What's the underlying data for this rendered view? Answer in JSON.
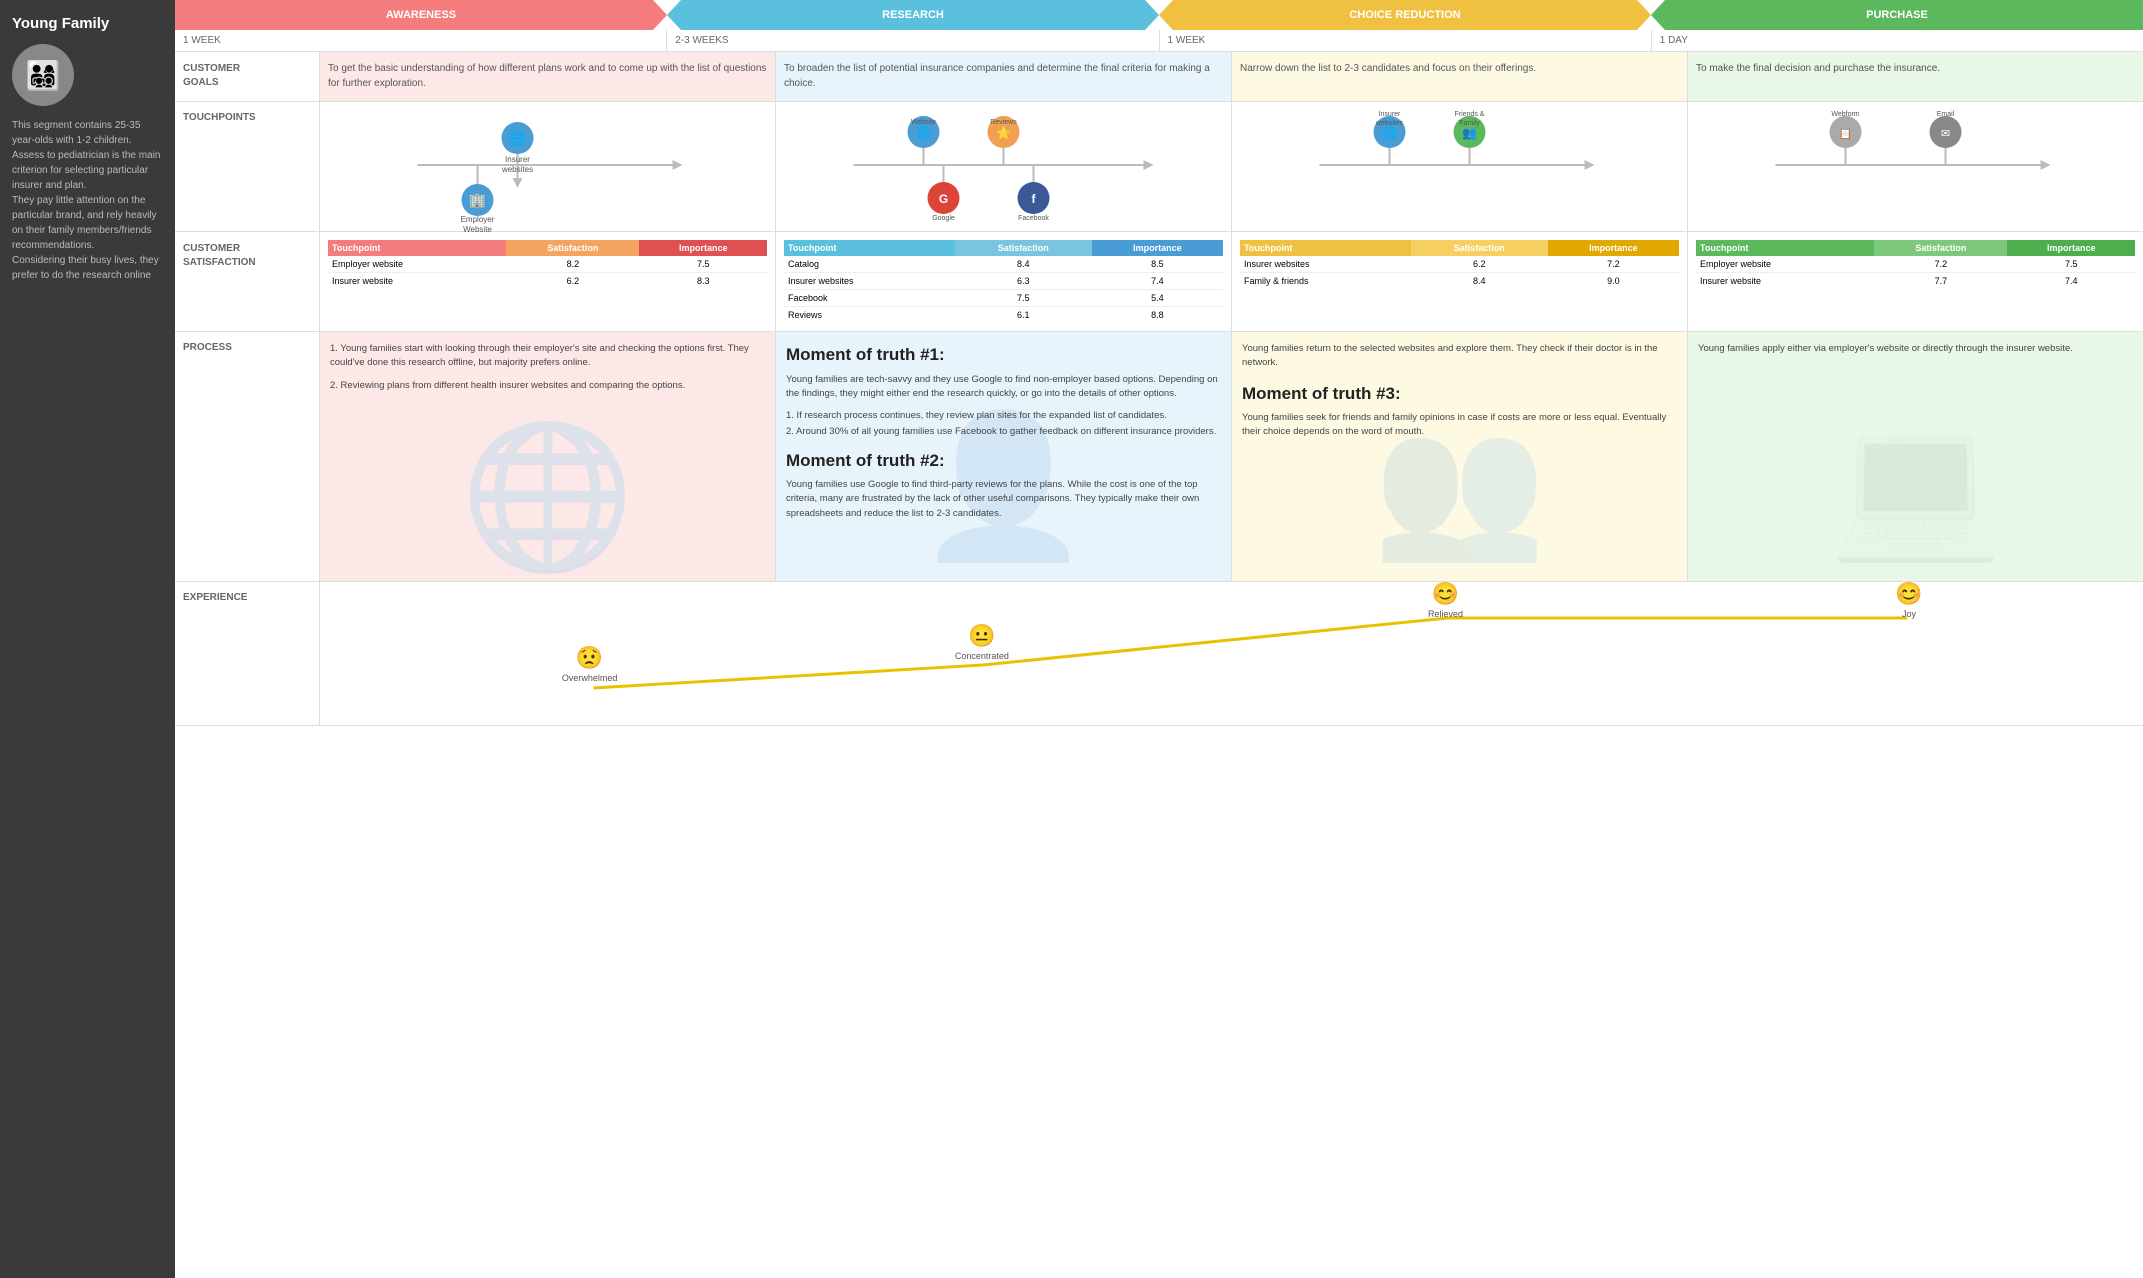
{
  "sidebar": {
    "title": "Young Family",
    "description": "This segment contains 25-35 year-olds with 1-2 children. Assess to pediatrician is the main criterion for selecting particular insurer and plan.\nThey pay little attention on the particular brand, and rely heavily on their family members/friends recommendations.\nConsidering their busy lives, they prefer to do the research online"
  },
  "phases": [
    {
      "id": "awareness",
      "label": "AWARENESS",
      "color": "#f47c7c",
      "bg": "#fde8e8"
    },
    {
      "id": "research",
      "label": "RESEARCH",
      "color": "#5bc0de",
      "bg": "#e8f4fb"
    },
    {
      "id": "choice",
      "label": "CHOICE REDUCTION",
      "color": "#f0c040",
      "bg": "#fdf9e3"
    },
    {
      "id": "purchase",
      "label": "PURCHASE",
      "color": "#5cb85c",
      "bg": "#e8f7e8"
    }
  ],
  "timeline": [
    "1 WEEK",
    "2-3 WEEKS",
    "1 WEEK",
    "1 DAY"
  ],
  "goals": [
    "To get the basic understanding of how different plans work and to come up with the list of questions for further exploration.",
    "To broaden the list of potential insurance companies and determine the final criteria for making a choice.",
    "Narrow down the list to 2-3 candidates and focus on their offerings.",
    "To make the final decision and purchase the insurance."
  ],
  "touchpoints": {
    "awareness": [
      {
        "label": "Insurer websites",
        "icon": "🌐",
        "color": "#4a9dd4",
        "y": "top"
      },
      {
        "label": "Employer Website",
        "icon": "🏢",
        "color": "#4a9dd4",
        "y": "bottom"
      }
    ],
    "research": [
      {
        "label": "Website",
        "icon": "🌐",
        "color": "#4a9dd4",
        "y": "top"
      },
      {
        "label": "Reviews",
        "icon": "⭐",
        "color": "#f0a050",
        "y": "top"
      },
      {
        "label": "Google",
        "icon": "G",
        "color": "#db4437",
        "y": "bottom"
      },
      {
        "label": "Facebook",
        "icon": "f",
        "color": "#3b5998",
        "y": "bottom"
      }
    ],
    "choice": [
      {
        "label": "Insurer websites",
        "icon": "🌐",
        "color": "#4a9dd4"
      },
      {
        "label": "Friends & Family",
        "icon": "👥",
        "color": "#5cb85c"
      }
    ],
    "purchase": [
      {
        "label": "Webform",
        "icon": "📋",
        "color": "#888"
      },
      {
        "label": "Email",
        "icon": "✉",
        "color": "#777"
      }
    ]
  },
  "satisfaction": {
    "awareness": {
      "headers": [
        "Touchpoint",
        "Satisfaction",
        "Importance"
      ],
      "rows": [
        [
          "Employer website",
          "8.2",
          "7.5"
        ],
        [
          "Insurer website",
          "6.2",
          "8.3"
        ]
      ]
    },
    "research": {
      "headers": [
        "Touchpoint",
        "Satisfaction",
        "Importance"
      ],
      "rows": [
        [
          "Catalog",
          "8.4",
          "8.5"
        ],
        [
          "Insurer websites",
          "6.3",
          "7.4"
        ],
        [
          "Facebook",
          "7.5",
          "5.4"
        ],
        [
          "Reviews",
          "6.1",
          "8.8"
        ]
      ]
    },
    "choice": {
      "headers": [
        "Touchpoint",
        "Satisfaction",
        "Importance"
      ],
      "rows": [
        [
          "Insurer websites",
          "6.2",
          "7.2"
        ],
        [
          "Family & friends",
          "8.4",
          "9.0"
        ]
      ]
    },
    "purchase": {
      "headers": [
        "Touchpoint",
        "Satisfaction",
        "Importance"
      ],
      "rows": [
        [
          "Employer website",
          "7.2",
          "7.5"
        ],
        [
          "Insurer website",
          "7.7",
          "7.4"
        ]
      ]
    }
  },
  "process": {
    "awareness": {
      "items": [
        "Young families start with looking through their employer's site and checking the options first. They could've done this research offline, but majority prefers online.",
        "Reviewing plans from different health insurer websites and comparing the options."
      ]
    },
    "research": {
      "moment1_title": "Moment of truth #1:",
      "moment1_text": "Young families are tech-savvy and they use Google to find non-employer based options. Depending on the findings, they might either end the research quickly, or go into the details of other options.",
      "sub_items": [
        "If research process continues, they review plan sites for the expanded list of candidates.",
        "Around 30% of all young families use Facebook to gather feedback on different insurance providers."
      ],
      "moment2_title": "Moment of truth #2:",
      "moment2_text": "Young families use Google to find third-party reviews for the plans. While the cost is one of the top criteria, many are frustrated by the lack of other useful comparisons. They typically make their own spreadsheets and reduce the list to 2-3 candidates."
    },
    "choice": {
      "text": "Young families return to the selected websites and explore them. They check if their doctor is in the network.",
      "moment3_title": "Moment of truth #3:",
      "moment3_text": "Young families seek for friends and family opinions in case if costs are more or less equal. Eventually their choice depends on the word of mouth."
    },
    "purchase": {
      "text": "Young families apply either via employer's website or directly through the insurer website."
    }
  },
  "experience": {
    "points": [
      {
        "label": "Overwhelmed",
        "emoji": "😟",
        "x": 14,
        "y": 78
      },
      {
        "label": "Concentrated",
        "emoji": "😐",
        "x": 36,
        "y": 60
      },
      {
        "label": "Relieved",
        "emoji": "😊",
        "x": 62,
        "y": 22
      },
      {
        "label": "Joy",
        "emoji": "😊",
        "x": 88,
        "y": 22
      }
    ]
  }
}
